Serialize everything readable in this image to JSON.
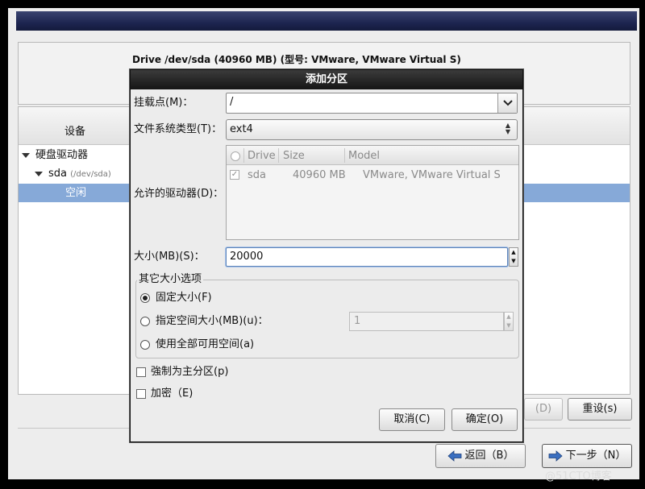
{
  "installer": {
    "drive_title": "Drive /dev/sda (40960 MB) (型号: VMware, VMware Virtual S)",
    "device_header": "设备",
    "tree": [
      {
        "label": "硬盘驱动器"
      },
      {
        "label": "sda",
        "sub": "(/dev/sda)"
      },
      {
        "label": "空闲"
      }
    ],
    "buttons": {
      "delete_partial": "(D)",
      "reset": "重设(s)",
      "back": "返回（B）",
      "next": "下一步（N）"
    },
    "watermark": "@51CTO博客"
  },
  "dialog": {
    "title": "添加分区",
    "mount_point_label": "挂载点(M)：",
    "mount_point_value": "/",
    "fs_type_label": "文件系统类型(T)：",
    "fs_type_value": "ext4",
    "allowed_drives_label": "允许的驱动器(D)：",
    "drive_columns": [
      "Drive",
      "Size",
      "Model"
    ],
    "drives": [
      {
        "checked": true,
        "drive": "sda",
        "size": "40960 MB",
        "model": "VMware, VMware Virtual S"
      }
    ],
    "size_label": "大小(MB)(S)：",
    "size_value": "20000",
    "other_size_title": "其它大小选项",
    "options": {
      "fixed": "固定大小(F)",
      "fill_to": "指定空间大小(MB)(u)：",
      "fill_all": "使用全部可用空间(a)"
    },
    "fill_to_value": "1",
    "force_primary": "強制为主分区(p)",
    "encrypt": "加密（E)",
    "cancel": "取消(C)",
    "ok": "确定(O)"
  },
  "colors": {
    "selection": "#86a9d8",
    "banner": "#1d2550",
    "dialog_title": "#151515"
  }
}
